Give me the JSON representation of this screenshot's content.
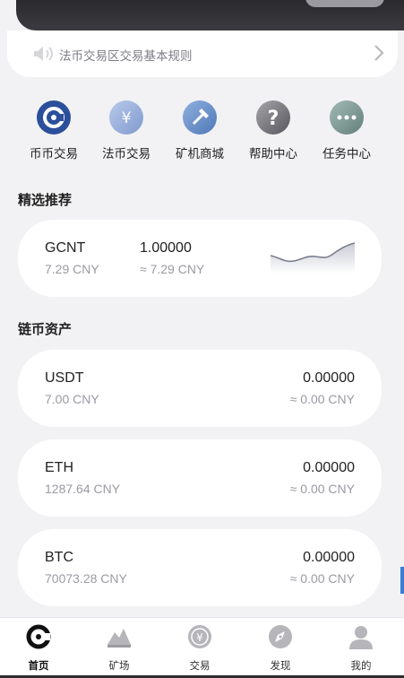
{
  "notice": {
    "text": "法币交易区交易基本规则"
  },
  "quick_menu": [
    {
      "label": "币币交易",
      "icon": "coin-exchange-icon",
      "color": "#2b4f9a"
    },
    {
      "label": "法币交易",
      "icon": "yen-icon",
      "color": "#8ea6d6"
    },
    {
      "label": "矿机商城",
      "icon": "mining-hammer-icon",
      "color": "#5f86c2"
    },
    {
      "label": "帮助中心",
      "icon": "help-icon",
      "color": "#6b6b70"
    },
    {
      "label": "任务中心",
      "icon": "more-icon",
      "color": "#7a9590"
    }
  ],
  "featured": {
    "title": "精选推荐",
    "item": {
      "symbol": "GCNT",
      "price_cny": "7.29 CNY",
      "value": "1.00000",
      "approx": "≈ 7.29 CNY"
    }
  },
  "assets": {
    "title": "链币资产",
    "items": [
      {
        "symbol": "USDT",
        "price_cny": "7.00 CNY",
        "value": "0.00000",
        "approx": "≈ 0.00 CNY"
      },
      {
        "symbol": "ETH",
        "price_cny": "1287.64 CNY",
        "value": "0.00000",
        "approx": "≈ 0.00 CNY"
      },
      {
        "symbol": "BTC",
        "price_cny": "70073.28 CNY",
        "value": "0.00000",
        "approx": "≈ 0.00 CNY"
      }
    ]
  },
  "tabbar": [
    {
      "label": "首页",
      "icon": "home-logo-icon",
      "active": true
    },
    {
      "label": "矿场",
      "icon": "mountain-icon",
      "active": false
    },
    {
      "label": "交易",
      "icon": "yen-coin-icon",
      "active": false
    },
    {
      "label": "发现",
      "icon": "compass-icon",
      "active": false
    },
    {
      "label": "我的",
      "icon": "user-icon",
      "active": false
    }
  ]
}
